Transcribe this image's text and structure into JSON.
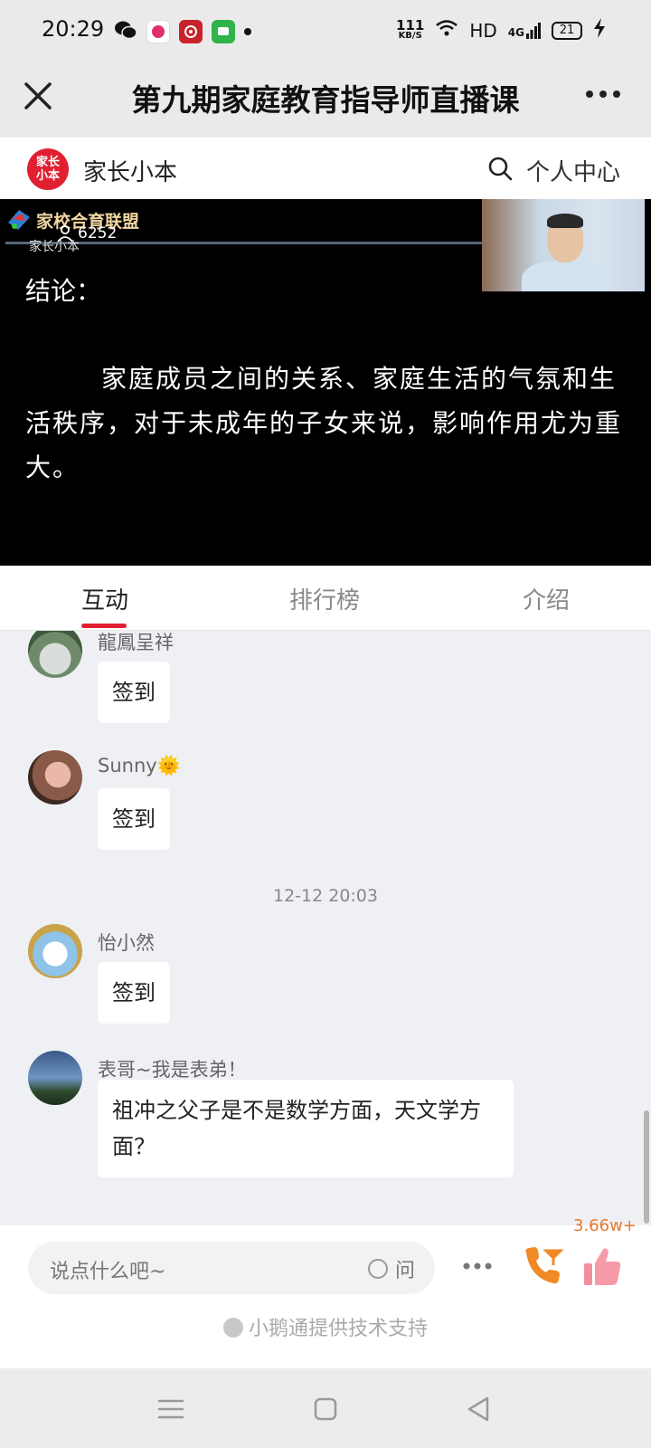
{
  "status_bar": {
    "time": "20:29",
    "net_speed_value": "111",
    "net_speed_unit": "KB/S",
    "hd": "HD",
    "network": "4G",
    "battery": "21"
  },
  "title_bar": {
    "title": "第九期家庭教育指导师直播课",
    "close_icon": "close-icon",
    "more_icon": "more-icon"
  },
  "header": {
    "logo_text": "家长小本",
    "brand_name": "家长小本",
    "search_icon": "search-icon",
    "user_center": "个人中心"
  },
  "video": {
    "watermark": "家校合育联盟",
    "brand_small": "家长小本",
    "viewers": "6252",
    "conclusion_label": "结论：",
    "body_text": "家庭成员之间的关系、家庭生活的气氛和生活秩序，对于未成年的子女来说，影响作用尤为重大。"
  },
  "tabs": [
    {
      "label": "互动",
      "active": true
    },
    {
      "label": "排行榜",
      "active": false
    },
    {
      "label": "介绍",
      "active": false
    }
  ],
  "chat": {
    "messages": [
      {
        "nickname": "龍鳳呈祥",
        "text": "签到"
      },
      {
        "nickname": "Sunny🌞",
        "text": "签到"
      },
      {
        "nickname": "怡小然",
        "text": "签到"
      },
      {
        "nickname": "表哥~我是表弟！",
        "text": "祖冲之父子是不是数学方面，天文学方面？"
      }
    ],
    "timestamp": "12-12 20:03"
  },
  "composer": {
    "placeholder": "说点什么吧~",
    "ask_label": "问",
    "like_count": "3.66w+",
    "support_text": "小鹅通提供技术支持"
  },
  "colors": {
    "accent": "#e02031",
    "like_count": "#e8782a",
    "phone_orange": "#f08a24"
  }
}
